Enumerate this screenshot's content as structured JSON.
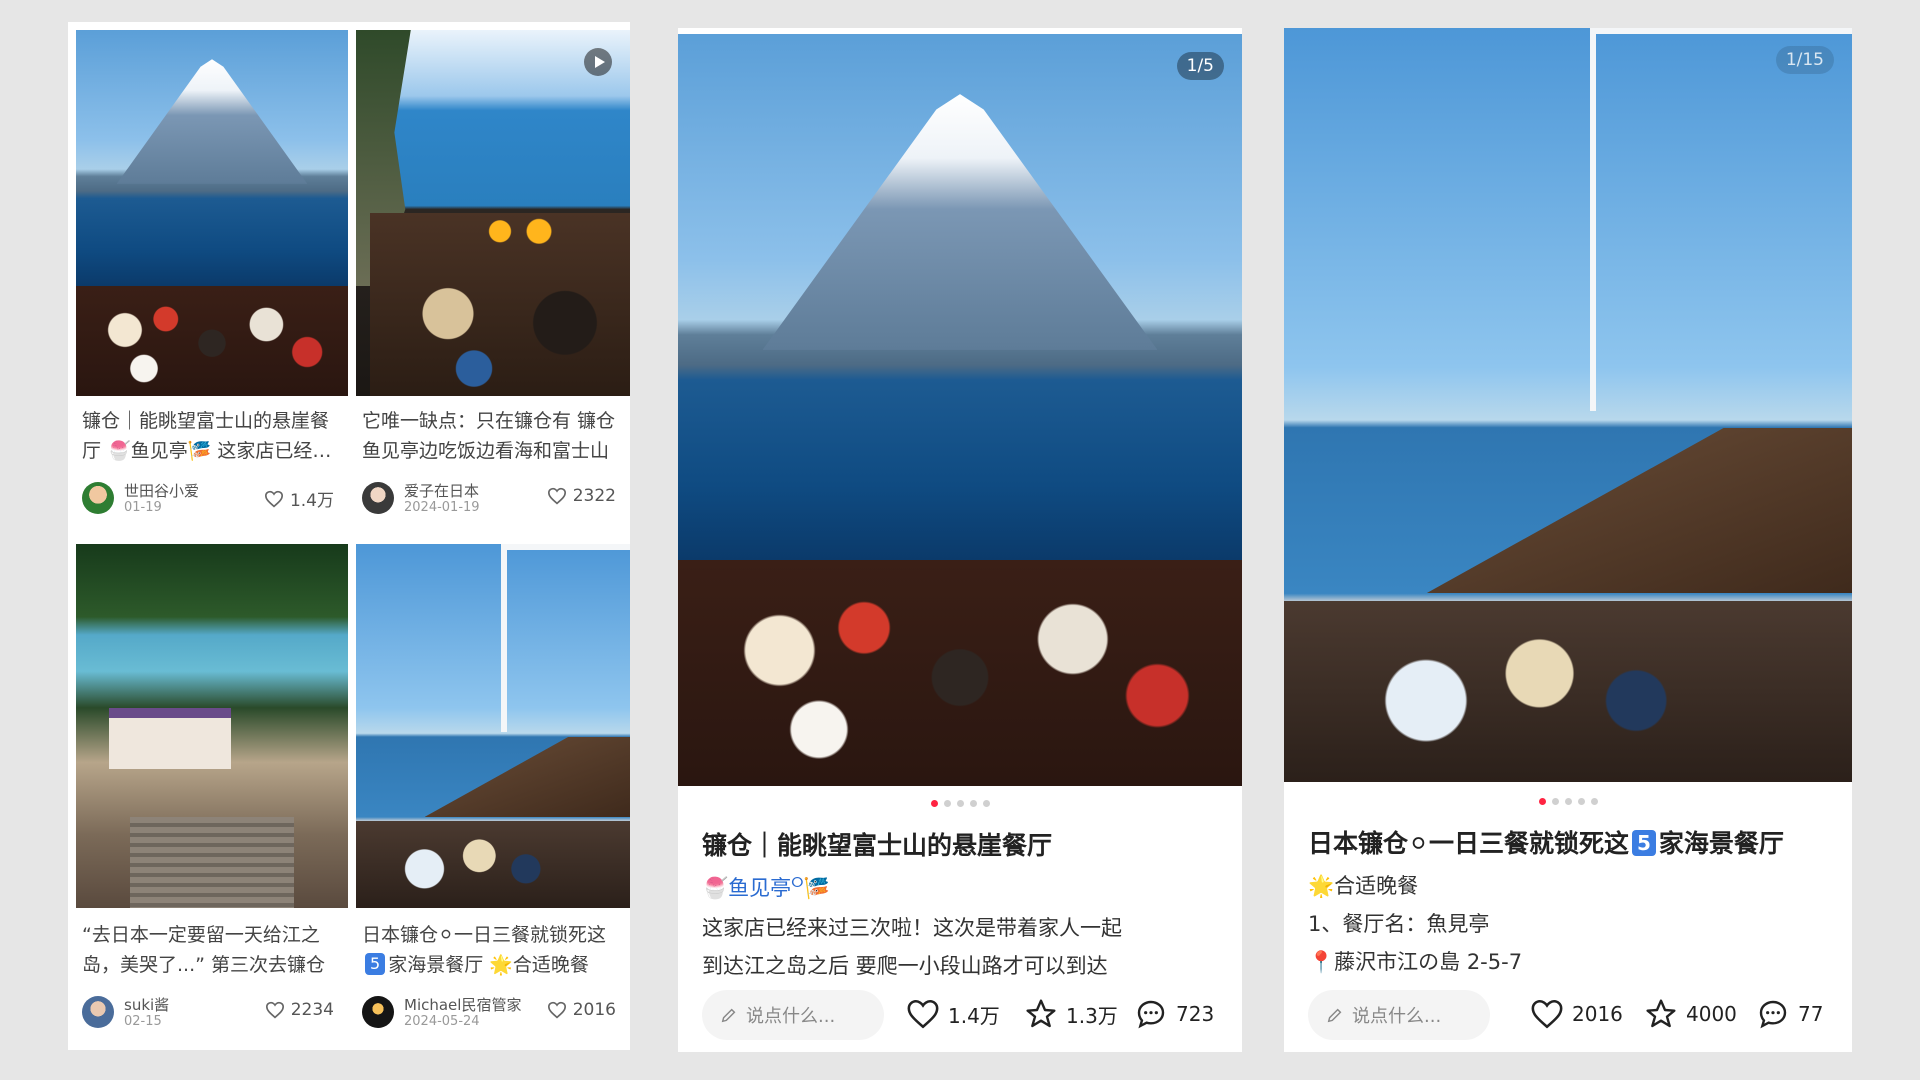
{
  "feed": [
    {
      "title": "镰仓｜能眺望富士山的悬崖餐厅 🍧鱼见亭🎏 这家店已经来过三次啦！",
      "author": "世田谷小爱",
      "date": "01-19",
      "likes": "1.4万"
    },
    {
      "title": "它唯一缺点：只在镰仓有 镰仓鱼见亭边吃饭边看海和富士山",
      "author": "爱子在日本",
      "date": "2024-01-19",
      "likes": "2322"
    },
    {
      "title": "“去日本一定要留一天给江之岛，美哭了...” 第三次去镰仓",
      "author": "suki酱",
      "date": "02-15",
      "likes": "2234"
    },
    {
      "title_pre": "日本镰仓",
      "title_mid": "一日三餐就锁死这",
      "title_num": "5",
      "title_post": "家海景餐厅 🌟合适晚餐",
      "author": "Michael民宿管家",
      "date": "2024-05-24",
      "likes": "2016"
    }
  ],
  "post1": {
    "counter": "1/5",
    "title": "镰仓｜能眺望富士山的悬崖餐厅",
    "line1_emoji": "🍧",
    "line1_place": "鱼见亭",
    "line1_emoji2": "🎏",
    "line2": "这家店已经来过三次啦！这次是带着家人一起",
    "line3": "到达江之岛之后 要爬一小段山路才可以到达",
    "comment_placeholder": "说点什么...",
    "likes": "1.4万",
    "stars": "1.3万",
    "comments": "723"
  },
  "post2": {
    "counter": "1/15",
    "title_pre": "日本镰仓",
    "title_mid": "一日三餐就锁死这",
    "title_num": "5",
    "title_post": "家海景餐厅",
    "line1": "🌟合适晚餐",
    "line2": "1、餐厅名：魚見亭",
    "line3": "📍藤沢市江の島 2-5-7",
    "comment_placeholder": "说点什么...",
    "likes": "2016",
    "stars": "4000",
    "comments": "77"
  },
  "colors": {
    "accent": "#ff2442",
    "link": "#2a6bd1",
    "tag": "#3b7de2"
  }
}
